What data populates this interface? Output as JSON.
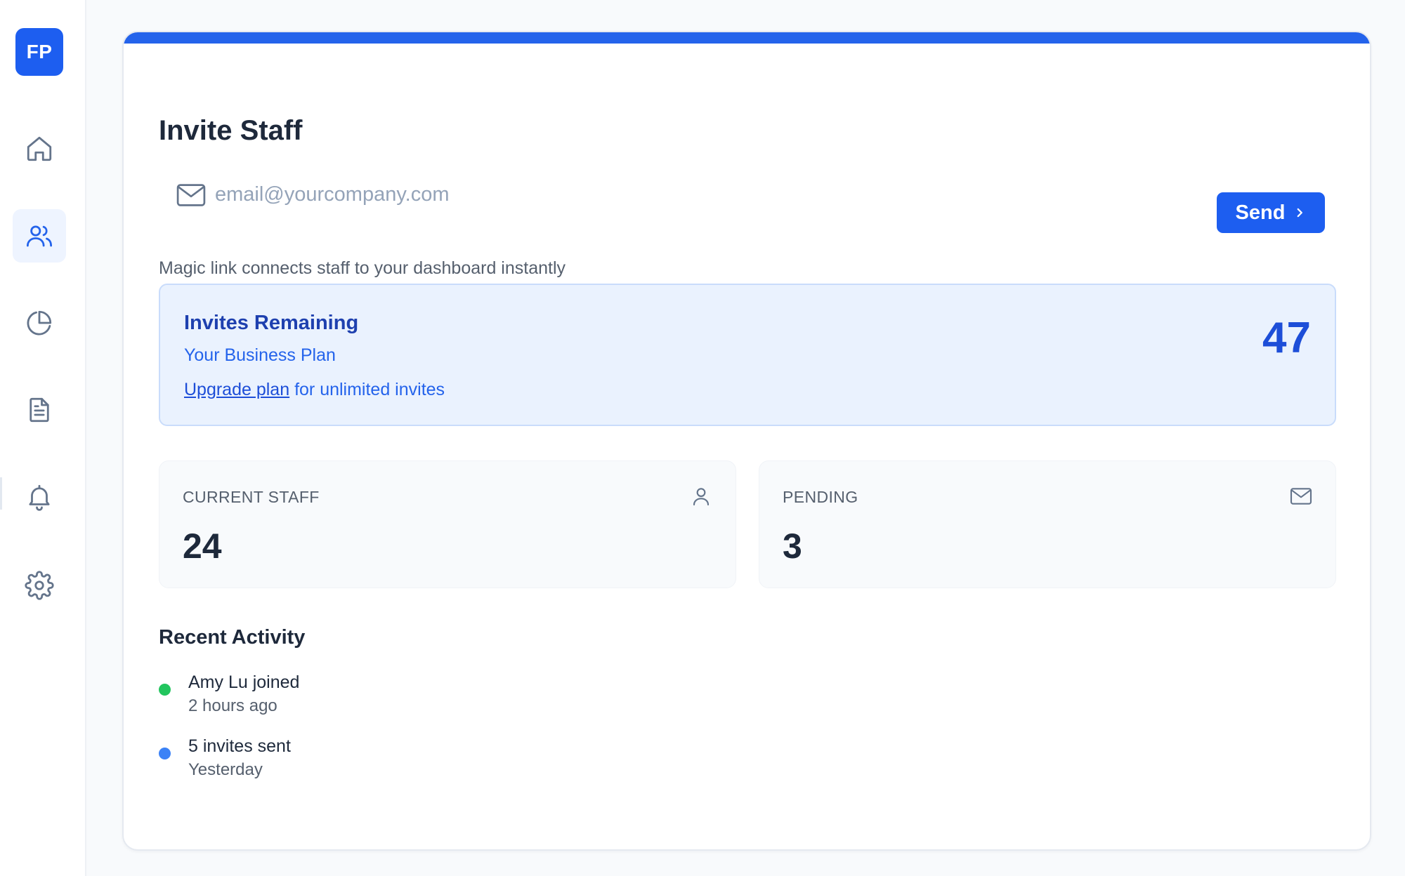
{
  "sidebar": {
    "logo_text": "FP",
    "items": [
      {
        "name": "home",
        "icon": "home-icon",
        "active": false
      },
      {
        "name": "staff",
        "icon": "users-icon",
        "active": true
      },
      {
        "name": "analytics",
        "icon": "pie-chart-icon",
        "active": false
      },
      {
        "name": "documents",
        "icon": "document-icon",
        "active": false
      },
      {
        "name": "notifications",
        "icon": "bell-icon",
        "active": false
      },
      {
        "name": "settings",
        "icon": "gear-icon",
        "active": false
      }
    ]
  },
  "invite": {
    "title": "Invite Staff",
    "email_placeholder": "email@yourcompany.com",
    "email_value": "",
    "send_label": "Send",
    "helper": "Magic link connects staff to your dashboard instantly"
  },
  "quota": {
    "title": "Invites Remaining",
    "plan": "Your Business Plan",
    "upgrade_link": "Upgrade plan",
    "upgrade_suffix": " for unlimited invites",
    "count": "47"
  },
  "stats": [
    {
      "label": "CURRENT STAFF",
      "value": "24",
      "icon": "user-icon"
    },
    {
      "label": "PENDING",
      "value": "3",
      "icon": "mail-icon"
    }
  ],
  "activity": {
    "title": "Recent Activity",
    "items": [
      {
        "text": "Amy Lu joined",
        "time": "2 hours ago",
        "color": "#22c55e"
      },
      {
        "text": "5 invites sent",
        "time": "Yesterday",
        "color": "#3b82f6"
      }
    ]
  },
  "colors": {
    "accent": "#1d5ef0",
    "accent_bar": "#2463eb",
    "quota_bg": "#eaf2fe",
    "success": "#22c55e",
    "info": "#3b82f6"
  }
}
